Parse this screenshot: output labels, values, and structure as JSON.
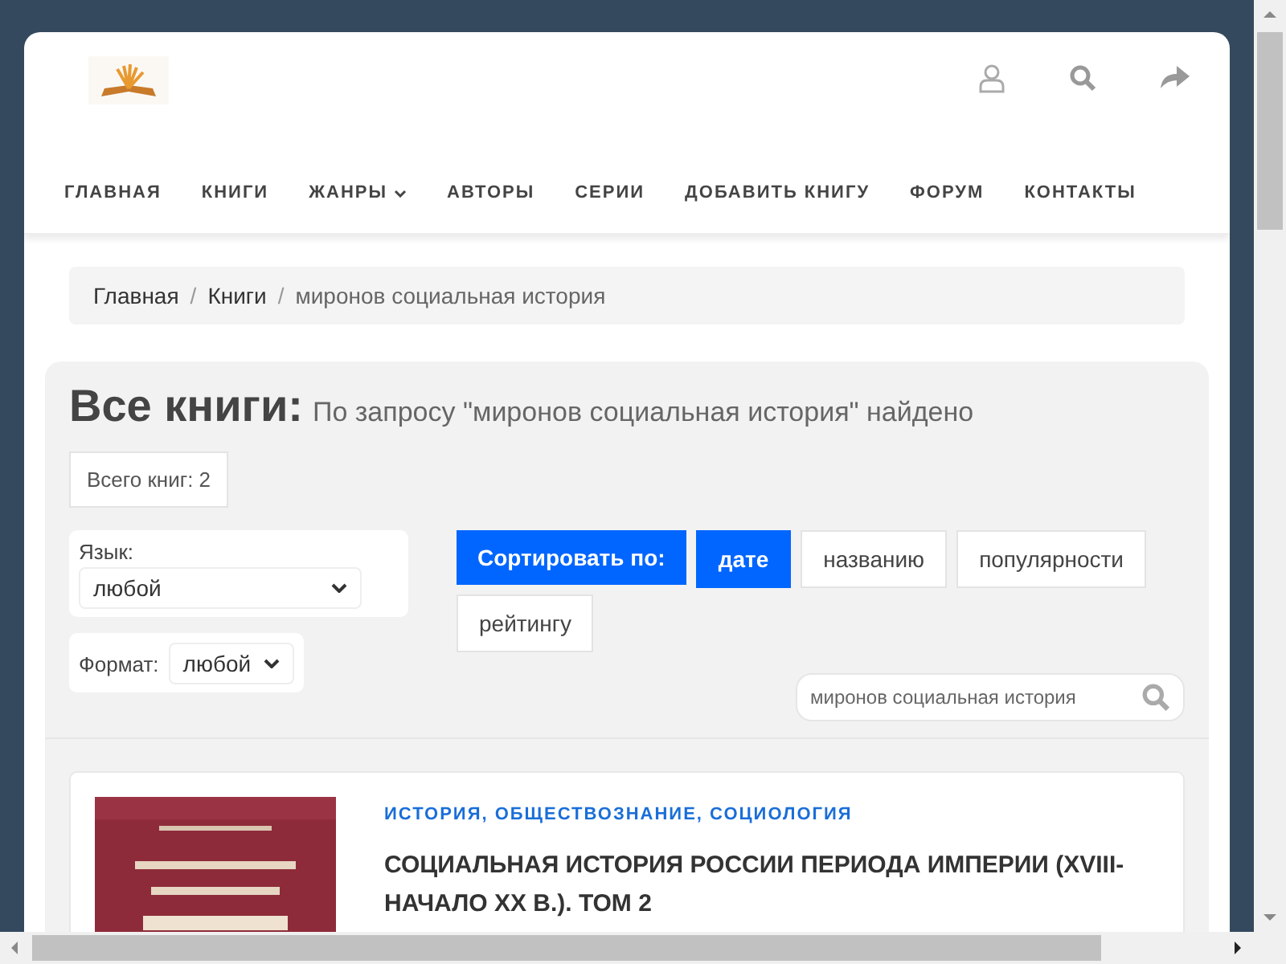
{
  "header": {
    "nav": [
      {
        "label": "ГЛАВНАЯ",
        "has_menu": false
      },
      {
        "label": "КНИГИ",
        "has_menu": false
      },
      {
        "label": "ЖАНРЫ",
        "has_menu": true
      },
      {
        "label": "АВТОРЫ",
        "has_menu": false
      },
      {
        "label": "СЕРИИ",
        "has_menu": false
      },
      {
        "label": "ДОБАВИТЬ КНИГУ",
        "has_menu": false
      },
      {
        "label": "ФОРУМ",
        "has_menu": false
      },
      {
        "label": "КОНТАКТЫ",
        "has_menu": false
      }
    ]
  },
  "breadcrumb": [
    {
      "label": "Главная",
      "current": false
    },
    {
      "separator": "/",
      "label": "Книги",
      "current": false
    },
    {
      "separator": "/",
      "label": "миронов социальная история",
      "current": true
    }
  ],
  "title": "Все книги:",
  "subtitle": "По запросу \"миронов социальная история\" найдено",
  "total": "Всего книг: 2",
  "filters": {
    "language": {
      "label": "Язык:",
      "value": "любой"
    },
    "format": {
      "label": "Формат:",
      "value": "любой"
    }
  },
  "sort": {
    "label": "Сортировать по:",
    "options": [
      {
        "label": "дате",
        "selected": true
      },
      {
        "label": "названию",
        "selected": false
      },
      {
        "label": "популярности",
        "selected": false
      },
      {
        "label": "рейтингу",
        "selected": false
      }
    ]
  },
  "search": {
    "value": "миронов социальная история"
  },
  "books": [
    {
      "categories": "ИСТОРИЯ, ОБЩЕСТВОЗНАНИЕ, СОЦИОЛОГИЯ",
      "title": "СОЦИАЛЬНАЯ ИСТОРИЯ РОССИИ ПЕРИОДА ИМПЕРИИ (XVIII-НАЧАЛО XX В.). ТОМ 2"
    }
  ]
}
